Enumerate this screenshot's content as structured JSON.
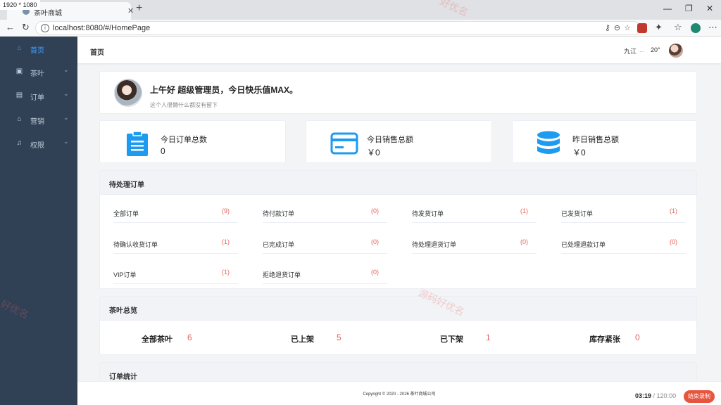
{
  "resolution_label": "1920 * 1080",
  "browser": {
    "tab_title": "茶叶商城",
    "tab_close": "✕",
    "new_tab": "+",
    "url": "localhost:8080/#/HomePage",
    "window_controls": [
      "—",
      "❐",
      "✕"
    ],
    "nav_back": "←",
    "nav_reload": "↻"
  },
  "sidebar": {
    "items": [
      {
        "label": "首页",
        "icon": "home-icon",
        "glyph": "⌂",
        "has_arrow": false,
        "active": true
      },
      {
        "label": "茶叶",
        "icon": "bag-icon",
        "glyph": "▣",
        "has_arrow": true,
        "active": false
      },
      {
        "label": "订单",
        "icon": "clipboard-icon",
        "glyph": "▤",
        "has_arrow": true,
        "active": false
      },
      {
        "label": "营销",
        "icon": "shop-icon",
        "glyph": "⌂",
        "has_arrow": true,
        "active": false
      },
      {
        "label": "权限",
        "icon": "bell-icon",
        "glyph": "♫",
        "has_arrow": true,
        "active": false
      }
    ],
    "arrow": "⌄"
  },
  "header": {
    "breadcrumb": "首页",
    "city": "九江",
    "weather_dots": "...",
    "temperature": "20°"
  },
  "welcome": {
    "greeting": "上午好 超级管理员，今日快乐值MAX。",
    "signature": "这个人很懒什么都没有留下"
  },
  "stats": [
    {
      "label": "今日订单总数",
      "value": "0",
      "icon": "clipboard-icon"
    },
    {
      "label": "今日销售总额",
      "value": "￥0",
      "icon": "credit-card-icon"
    },
    {
      "label": "昨日销售总额",
      "value": "￥0",
      "icon": "database-icon"
    }
  ],
  "pending_orders": {
    "title": "待处理订单",
    "items": [
      {
        "label": "全部订单",
        "count": "(9)"
      },
      {
        "label": "待付款订单",
        "count": "(0)"
      },
      {
        "label": "待发货订单",
        "count": "(1)"
      },
      {
        "label": "已发货订单",
        "count": "(1)"
      },
      {
        "label": "待确认收货订单",
        "count": "(1)"
      },
      {
        "label": "已完成订单",
        "count": "(0)"
      },
      {
        "label": "待处理退货订单",
        "count": "(0)"
      },
      {
        "label": "已处理退款订单",
        "count": "(0)"
      },
      {
        "label": "VIP订单",
        "count": "(1)"
      },
      {
        "label": "拒绝退货订单",
        "count": "(0)"
      }
    ]
  },
  "tea_overview": {
    "title": "茶叶总览",
    "items": [
      {
        "label": "全部茶叶",
        "value": "6"
      },
      {
        "label": "已上架",
        "value": "5"
      },
      {
        "label": "已下架",
        "value": "1"
      },
      {
        "label": "库存紧张",
        "value": "0"
      }
    ]
  },
  "order_stats": {
    "title": "订单统计"
  },
  "footer": {
    "copyright": "Copyright © 2020 - 2026  茶叶商城公司",
    "recording_time": "03:19",
    "recording_total": "/ 120:00",
    "end_button": "结束录制"
  },
  "watermarks": [
    "好优名",
    "源码好优名",
    "好优名"
  ],
  "colors": {
    "sidebar_bg": "#304156",
    "accent": "#409eff",
    "count_red": "#e8625a",
    "stat_icon_blue": "#1d9bf0"
  }
}
